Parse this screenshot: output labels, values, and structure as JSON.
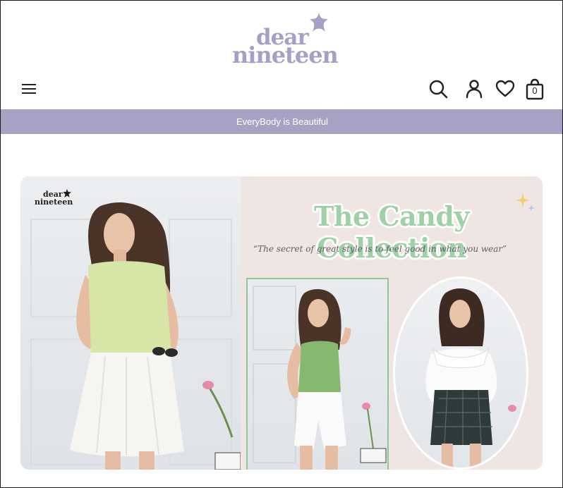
{
  "brand": {
    "logo_line1": "dear",
    "logo_line2": "nineteen",
    "logo_color": "#a79fc6"
  },
  "header": {
    "icons": [
      "hamburger-menu-icon",
      "search-icon",
      "account-icon",
      "heart-icon",
      "shopping-bag-icon"
    ],
    "cart_count": "0"
  },
  "announcement": {
    "text": "EveryBody is Beautiful",
    "bg_color": "#a7a1c3"
  },
  "banner": {
    "mini_logo_line1": "dear",
    "mini_logo_line2": "nineteen",
    "headline": "The Candy Collection",
    "tagline": "“The secret of great style is to feel good in what you wear”",
    "headline_color": "#9fd0a6",
    "background_color": "#efe5e2"
  }
}
